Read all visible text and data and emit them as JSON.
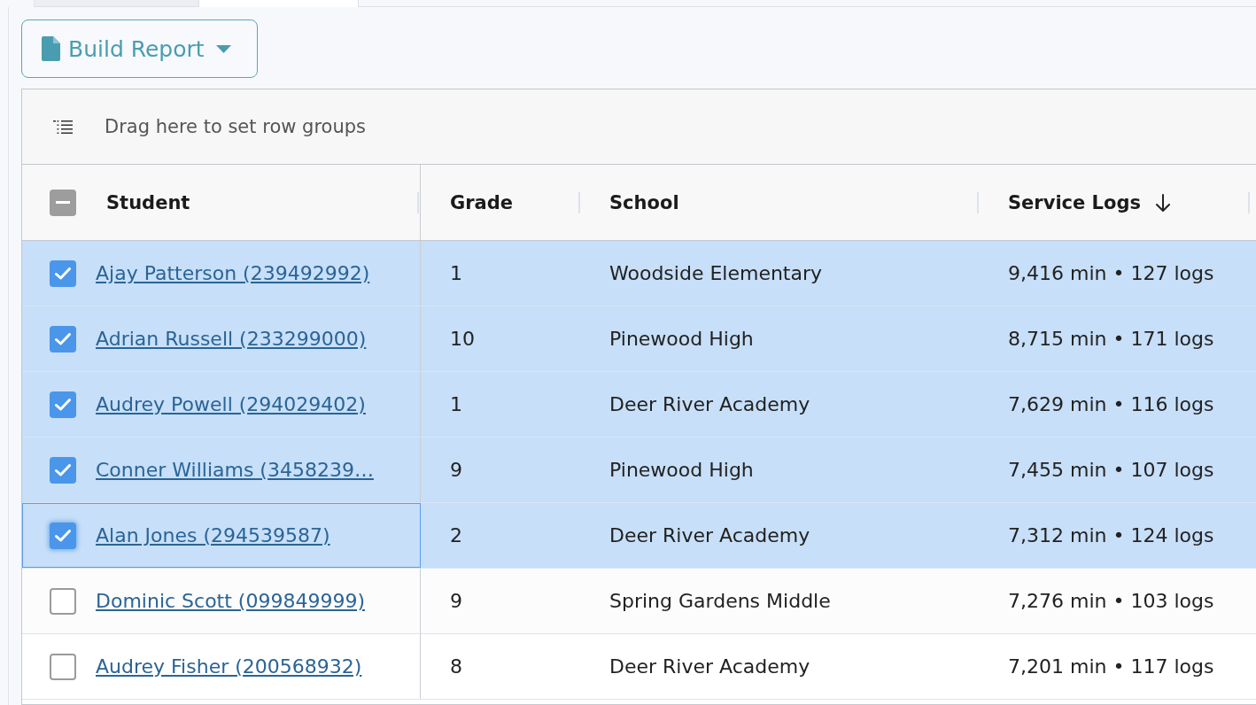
{
  "tabs": [
    {
      "selected": false
    },
    {
      "selected": true
    }
  ],
  "toolbar": {
    "build_report_button": {
      "label": "Build Report"
    }
  },
  "grid": {
    "row_group_panel": {
      "text": "Drag here to set row groups"
    },
    "select_all": {
      "indeterminate": true
    },
    "columns": [
      {
        "label": "Student",
        "sort_descending": false
      },
      {
        "label": "Grade",
        "sort_descending": false
      },
      {
        "label": "School",
        "sort_descending": false
      },
      {
        "label": "Service Logs",
        "sort_descending": true
      }
    ],
    "rows": [
      {
        "student": "Ajay Patterson (239492992)",
        "grade": "1",
        "school": "Woodside Elementary",
        "service_logs": "9,416 min • 127 logs",
        "selected": true,
        "focused": false
      },
      {
        "student": "Adrian Russell (233299000)",
        "grade": "10",
        "school": "Pinewood High",
        "service_logs": "8,715 min • 171 logs",
        "selected": true,
        "focused": false
      },
      {
        "student": "Audrey Powell (294029402)",
        "grade": "1",
        "school": "Deer River Academy",
        "service_logs": "7,629 min • 116 logs",
        "selected": true,
        "focused": false
      },
      {
        "student": "Conner Williams (3458239…",
        "grade": "9",
        "school": "Pinewood High",
        "service_logs": "7,455 min • 107 logs",
        "selected": true,
        "focused": false
      },
      {
        "student": "Alan Jones (294539587)",
        "grade": "2",
        "school": "Deer River Academy",
        "service_logs": "7,312 min • 124 logs",
        "selected": true,
        "focused": true
      },
      {
        "student": "Dominic Scott (099849999)",
        "grade": "9",
        "school": "Spring Gardens Middle",
        "service_logs": "7,276 min • 103 logs",
        "selected": false,
        "focused": false
      },
      {
        "student": "Audrey Fisher (200568932)",
        "grade": "8",
        "school": "Deer River Academy",
        "service_logs": "7,201 min • 117 logs",
        "selected": false,
        "focused": false
      }
    ]
  }
}
